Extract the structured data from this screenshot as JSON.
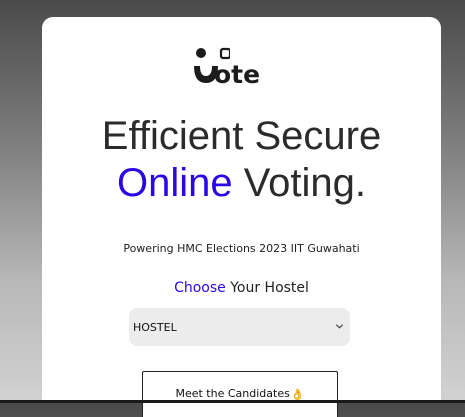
{
  "logo": {
    "text": "ote",
    "icon": "vote-smiley-logo"
  },
  "headline": {
    "line1": "Efficient Secure",
    "line2_accent": "Online",
    "line2_rest": " Voting."
  },
  "tagline": "Powering HMC Elections 2023 IIT Guwahati",
  "choose": {
    "accent": "Choose",
    "rest": " Your Hostel"
  },
  "hostel_select": {
    "value": "HOSTEL",
    "icon": "chevron-down-icon"
  },
  "cta": {
    "label": "Meet the Candidates",
    "emoji": "👌"
  },
  "colors": {
    "accent": "#2b06e8",
    "text": "#2b2b2b",
    "select_bg": "#ececec"
  }
}
